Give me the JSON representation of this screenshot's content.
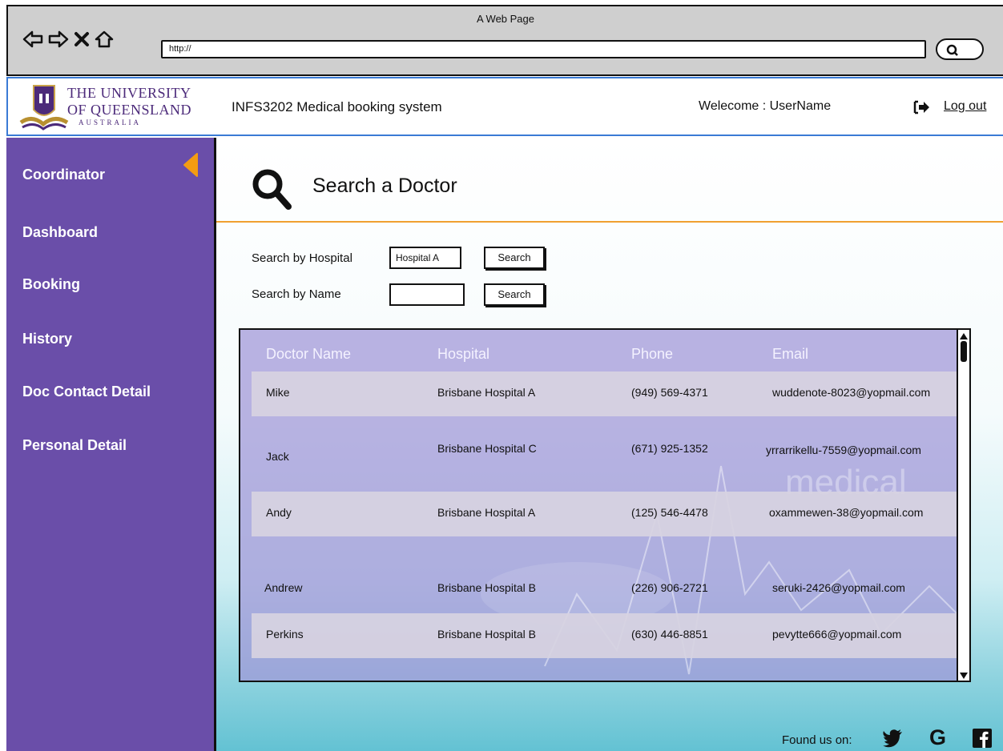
{
  "browser": {
    "window_title": "A Web Page",
    "url": "http://"
  },
  "header": {
    "university": {
      "line1": "THE UNIVERSITY",
      "line2": "OF QUEENSLAND",
      "line3": "AUSTRALIA"
    },
    "system_title": "INFS3202 Medical booking system",
    "welcome": "Welecome : UserName",
    "logout_label": "Log out"
  },
  "sidebar": {
    "items": [
      {
        "label": "Coordinator"
      },
      {
        "label": "Dashboard"
      },
      {
        "label": "Booking"
      },
      {
        "label": "History"
      },
      {
        "label": "Doc Contact Detail"
      },
      {
        "label": "Personal Detail"
      }
    ]
  },
  "main": {
    "title": "Search a Doctor",
    "search": {
      "hospital_label": "Search by Hospital",
      "hospital_value": "Hospital A",
      "name_label": "Search by Name",
      "name_value": "",
      "button_label": "Search"
    },
    "table": {
      "columns": [
        "Doctor Name",
        "Hospital",
        "Phone",
        "Email"
      ],
      "rows": [
        {
          "name": "Mike",
          "hospital": "Brisbane Hospital A",
          "phone": "(949) 569-4371",
          "email": "wuddenote-8023@yopmail.com"
        },
        {
          "name": "Jack",
          "hospital": "Brisbane Hospital C",
          "phone": "(671) 925-1352",
          "email": "yrrarrikellu-7559@yopmail.com"
        },
        {
          "name": "Andy",
          "hospital": "Brisbane Hospital A",
          "phone": "(125) 546-4478",
          "email": "oxammewen-38@yopmail.com"
        },
        {
          "name": "Andrew",
          "hospital": "Brisbane Hospital B",
          "phone": "(226) 906-2721",
          "email": "seruki-2426@yopmail.com"
        },
        {
          "name": "Perkins",
          "hospital": "Brisbane Hospital B",
          "phone": "(630) 446-8851",
          "email": "pevytte666@yopmail.com"
        }
      ],
      "watermark": "medical"
    }
  },
  "footer": {
    "found_label": "Found us on:",
    "social_icons": [
      "twitter-icon",
      "google-icon",
      "facebook-icon"
    ]
  },
  "colors": {
    "sidebar": "#6a4ea9",
    "header_border": "#3a7bd5",
    "accent_arrow": "#f39c12",
    "divider": "#f0a030"
  }
}
